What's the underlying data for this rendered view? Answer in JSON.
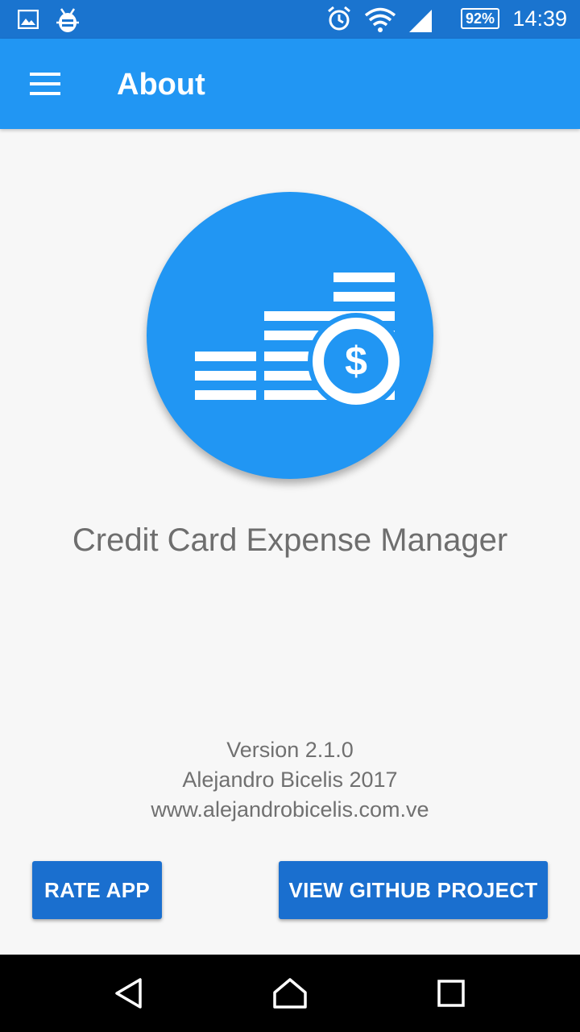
{
  "status_bar": {
    "time": "14:39",
    "battery": "92%",
    "icons": [
      "gallery-icon",
      "android-debug-icon",
      "alarm-icon",
      "wifi-icon",
      "signal-icon",
      "battery-icon"
    ]
  },
  "app_bar": {
    "title": "About",
    "menu_icon": "hamburger-menu-icon"
  },
  "logo": {
    "icon": "coins-dollar-icon",
    "color": "#2196f3"
  },
  "app_name": "Credit Card Expense Manager",
  "info": {
    "version": "Version 2.1.0",
    "author": "Alejandro Bicelis 2017",
    "website": "www.alejandrobicelis.com.ve"
  },
  "buttons": {
    "rate_label": "RATE APP",
    "github_label": "VIEW GITHUB PROJECT"
  },
  "nav_bar": {
    "back_icon": "back-triangle-icon",
    "home_icon": "home-icon",
    "recents_icon": "recents-square-icon"
  },
  "colors": {
    "primary": "#2196f3",
    "primary_dark": "#1a74cf",
    "button": "#1a6fcf"
  }
}
